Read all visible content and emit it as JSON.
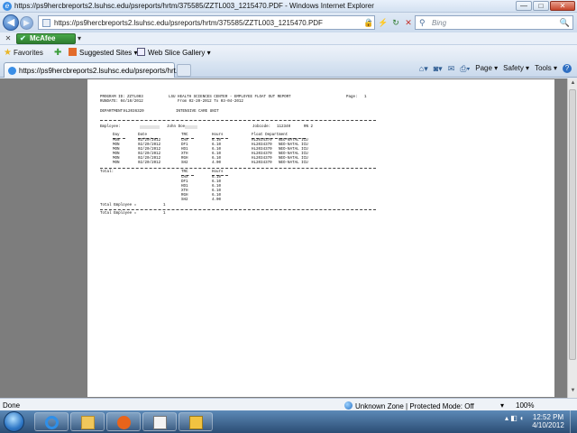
{
  "window": {
    "title": "https://ps9hercbreports2.lsuhsc.edu/psreports/hrtm/375585/ZZTL003_1215470.PDF - Windows Internet Explorer",
    "minimize": "—",
    "maximize": "□",
    "close": "✕"
  },
  "address_bar": {
    "url": "https://ps9hercbreports2.lsuhsc.edu/psreports/hrtm/375585/ZZTL003_1215470.PDF",
    "search_placeholder": "Bing"
  },
  "mcafee": {
    "label": "McAfee"
  },
  "favorites_bar": {
    "favorites_label": "Favorites",
    "suggested_sites": "Suggested Sites ▾",
    "web_slice_gallery": "Web Slice Gallery ▾"
  },
  "tab": {
    "label": "https://ps9hercbreports2.lsuhsc.edu/psreports/hrt..."
  },
  "command_bar": {
    "page": "Page ▾",
    "safety": "Safety ▾",
    "tools": "Tools ▾"
  },
  "report": {
    "program_id": "PROGRAM ID: ZZTL003",
    "run_date": "RUNDATE: 04/10/2012",
    "org_title": "LSU HEALTH SCIENCES CENTER - EMPLOYEE FLOAT OUT REPORT",
    "date_range": "From 02-20-2012 To 03-04-2012",
    "page_label": "Page:",
    "page_number": "1",
    "department_label": "DEPARTMENT:",
    "department_id": "HL2036320",
    "department_name": "INTENSIVE CARE UNIT",
    "employee_label": "Employee:",
    "employee_name": "John Doe",
    "jobcode_label": "Jobcode:",
    "jobcode": "112340",
    "rn_label": "RN 2",
    "columns": [
      "Day",
      "Date",
      "TRC",
      "Hours",
      "Float Department"
    ],
    "rows": [
      {
        "day": "MON",
        "date": "02/20/2012",
        "trc": "CHX",
        "hours": "6.10",
        "dept_id": "HL2034370",
        "dept_name": "NEO-NATAL ICU"
      },
      {
        "day": "MON",
        "date": "02/20/2012",
        "trc": "DF1",
        "hours": "6.10",
        "dept_id": "HL2034370",
        "dept_name": "NEO-NATAL ICU"
      },
      {
        "day": "MON",
        "date": "02/20/2012",
        "trc": "HD1",
        "hours": "6.10",
        "dept_id": "HL2034370",
        "dept_name": "NEO-NATAL ICU"
      },
      {
        "day": "MON",
        "date": "02/20/2012",
        "trc": "XTH",
        "hours": "6.10",
        "dept_id": "HL2034370",
        "dept_name": "NEO-NATAL ICU"
      },
      {
        "day": "MON",
        "date": "02/20/2012",
        "trc": "RGH",
        "hours": "6.10",
        "dept_id": "HL2034370",
        "dept_name": "NEO-NATAL ICU"
      },
      {
        "day": "MON",
        "date": "02/20/2012",
        "trc": "SH2",
        "hours": "4.00",
        "dept_id": "HL2034370",
        "dept_name": "NEO-NATAL ICU"
      }
    ],
    "total_label": "Total:",
    "totals_columns": [
      "TRC",
      "Hours"
    ],
    "totals": [
      {
        "trc": "CHX",
        "hours": "6.10"
      },
      {
        "trc": "DF1",
        "hours": "6.10"
      },
      {
        "trc": "HD1",
        "hours": "6.10"
      },
      {
        "trc": "XTH",
        "hours": "6.10"
      },
      {
        "trc": "RGH",
        "hours": "6.10"
      },
      {
        "trc": "SH2",
        "hours": "4.00"
      }
    ],
    "total_employee_label": "Total Employee =",
    "total_employee_value": "1",
    "total_employees_label": "Total Employee =",
    "total_employees_value": "1"
  },
  "status_bar": {
    "status": "Done",
    "zone": "Unknown Zone | Protected Mode: Off",
    "zoom": "100%"
  },
  "taskbar": {
    "time": "12:52 PM",
    "date": "4/10/2012"
  },
  "icons": [
    "ie-icon",
    "back-icon",
    "forward-icon",
    "lock-icon",
    "refresh-icon",
    "stop-icon",
    "search-icon",
    "favorites-star-icon",
    "home-icon",
    "rss-icon",
    "print-icon",
    "help-icon",
    "globe-icon",
    "start-orb-icon",
    "folder-icon",
    "media-player-icon",
    "pdf-icon",
    "outlook-icon"
  ]
}
